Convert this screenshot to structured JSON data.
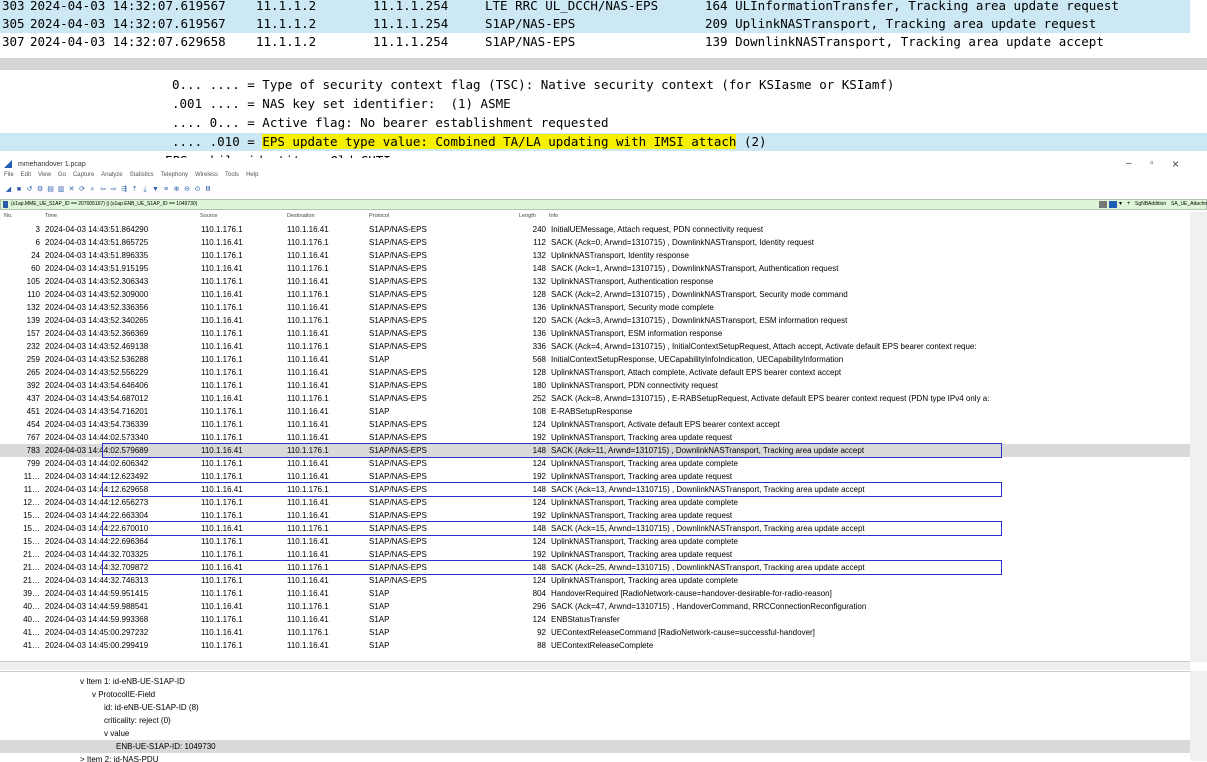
{
  "top_packets": [
    {
      "no": "303",
      "time": "2024-04-03 14:32:07.619567",
      "src": "11.1.1.2",
      "dst": "11.1.1.254",
      "proto": "LTE RRC UL_DCCH/NAS-EPS",
      "info": "164 ULInformationTransfer, Tracking area update request",
      "selected": true
    },
    {
      "no": "305",
      "time": "2024-04-03 14:32:07.619567",
      "src": "11.1.1.2",
      "dst": "11.1.1.254",
      "proto": "S1AP/NAS-EPS",
      "info": "209 UplinkNASTransport, Tracking area update request",
      "selected": true
    },
    {
      "no": "307",
      "time": "2024-04-03 14:32:07.629658",
      "src": "11.1.1.2",
      "dst": "11.1.1.254",
      "proto": "S1AP/NAS-EPS",
      "info": "139 DownlinkNASTransport, Tracking area update accept",
      "selected": false
    }
  ],
  "top_detail": [
    {
      "text": "0... .... = Type of security context flag (TSC): Native security context (for KSIasme or KSIamf)"
    },
    {
      "text": ".001 .... = NAS key set identifier:  (1) ASME"
    },
    {
      "text": ".... 0... = Active flag: No bearer establishment requested"
    },
    {
      "prefix": ".... .010 = ",
      "highlight": "EPS update type value: Combined TA/LA updating with IMSI attach",
      "suffix": " (2)",
      "selected": true
    },
    {
      "text": "v EPS mobile identity - Old GUTI"
    }
  ],
  "window": {
    "title": "mmehandover 1.pcap",
    "menu": [
      "File",
      "Edit",
      "View",
      "Go",
      "Capture",
      "Analyze",
      "Statistics",
      "Telephony",
      "Wireless",
      "Tools",
      "Help"
    ],
    "filter": "(s1ap.MME_UE_S1AP_ID == 207005167) || (s1ap.ENB_UE_S1AP_ID == 1049730)",
    "filter_buttons": [
      "SgNBAddition",
      "SA_UE_Attachment"
    ],
    "minimize": "–",
    "maximize": "▫",
    "close": "×",
    "columns": {
      "no": "No.",
      "time": "Time",
      "src": "Source",
      "dst": "Destination",
      "proto": "Protocol",
      "len": "Length",
      "info": "Info"
    }
  },
  "packets": [
    {
      "no": "3",
      "time": "2024-04-03 14:43:51.864290",
      "src": "110.1.176.1",
      "dst": "110.1.16.41",
      "proto": "S1AP/NAS-EPS",
      "len": "240",
      "info": "InitialUEMessage, Attach request, PDN connectivity request"
    },
    {
      "no": "6",
      "time": "2024-04-03 14:43:51.865725",
      "src": "110.1.16.41",
      "dst": "110.1.176.1",
      "proto": "S1AP/NAS-EPS",
      "len": "112",
      "info": "SACK (Ack=0, Arwnd=1310715) , DownlinkNASTransport, Identity request"
    },
    {
      "no": "24",
      "time": "2024-04-03 14:43:51.896335",
      "src": "110.1.176.1",
      "dst": "110.1.16.41",
      "proto": "S1AP/NAS-EPS",
      "len": "132",
      "info": "UplinkNASTransport, Identity response"
    },
    {
      "no": "60",
      "time": "2024-04-03 14:43:51.915195",
      "src": "110.1.16.41",
      "dst": "110.1.176.1",
      "proto": "S1AP/NAS-EPS",
      "len": "148",
      "info": "SACK (Ack=1, Arwnd=1310715) , DownlinkNASTransport, Authentication request"
    },
    {
      "no": "105",
      "time": "2024-04-03 14:43:52.306343",
      "src": "110.1.176.1",
      "dst": "110.1.16.41",
      "proto": "S1AP/NAS-EPS",
      "len": "132",
      "info": "UplinkNASTransport, Authentication response"
    },
    {
      "no": "110",
      "time": "2024-04-03 14:43:52.309000",
      "src": "110.1.16.41",
      "dst": "110.1.176.1",
      "proto": "S1AP/NAS-EPS",
      "len": "128",
      "info": "SACK (Ack=2, Arwnd=1310715) , DownlinkNASTransport, Security mode command"
    },
    {
      "no": "132",
      "time": "2024-04-03 14:43:52.336356",
      "src": "110.1.176.1",
      "dst": "110.1.16.41",
      "proto": "S1AP/NAS-EPS",
      "len": "136",
      "info": "UplinkNASTransport, Security mode complete"
    },
    {
      "no": "139",
      "time": "2024-04-03 14:43:52.340265",
      "src": "110.1.16.41",
      "dst": "110.1.176.1",
      "proto": "S1AP/NAS-EPS",
      "len": "120",
      "info": "SACK (Ack=3, Arwnd=1310715) , DownlinkNASTransport, ESM information request"
    },
    {
      "no": "157",
      "time": "2024-04-03 14:43:52.366369",
      "src": "110.1.176.1",
      "dst": "110.1.16.41",
      "proto": "S1AP/NAS-EPS",
      "len": "136",
      "info": "UplinkNASTransport, ESM information response"
    },
    {
      "no": "232",
      "time": "2024-04-03 14:43:52.469138",
      "src": "110.1.16.41",
      "dst": "110.1.176.1",
      "proto": "S1AP/NAS-EPS",
      "len": "336",
      "info": "SACK (Ack=4, Arwnd=1310715) , InitialContextSetupRequest, Attach accept, Activate default EPS bearer context reque:"
    },
    {
      "no": "259",
      "time": "2024-04-03 14:43:52.536288",
      "src": "110.1.176.1",
      "dst": "110.1.16.41",
      "proto": "S1AP",
      "len": "568",
      "info": "InitialContextSetupResponse, UECapabilityInfoIndication, UECapabilityInformation"
    },
    {
      "no": "265",
      "time": "2024-04-03 14:43:52.556229",
      "src": "110.1.176.1",
      "dst": "110.1.16.41",
      "proto": "S1AP/NAS-EPS",
      "len": "128",
      "info": "UplinkNASTransport, Attach complete, Activate default EPS bearer context accept"
    },
    {
      "no": "392",
      "time": "2024-04-03 14:43:54.646406",
      "src": "110.1.176.1",
      "dst": "110.1.16.41",
      "proto": "S1AP/NAS-EPS",
      "len": "180",
      "info": "UplinkNASTransport, PDN connectivity request"
    },
    {
      "no": "437",
      "time": "2024-04-03 14:43:54.687012",
      "src": "110.1.16.41",
      "dst": "110.1.176.1",
      "proto": "S1AP/NAS-EPS",
      "len": "252",
      "info": "SACK (Ack=8, Arwnd=1310715) , E-RABSetupRequest, Activate default EPS bearer context request (PDN type IPv4 only a:"
    },
    {
      "no": "451",
      "time": "2024-04-03 14:43:54.716201",
      "src": "110.1.176.1",
      "dst": "110.1.16.41",
      "proto": "S1AP",
      "len": "108",
      "info": "E-RABSetupResponse"
    },
    {
      "no": "454",
      "time": "2024-04-03 14:43:54.736339",
      "src": "110.1.176.1",
      "dst": "110.1.16.41",
      "proto": "S1AP/NAS-EPS",
      "len": "124",
      "info": "UplinkNASTransport, Activate default EPS bearer context accept"
    },
    {
      "no": "767",
      "time": "2024-04-03 14:44:02.573340",
      "src": "110.1.176.1",
      "dst": "110.1.16.41",
      "proto": "S1AP/NAS-EPS",
      "len": "192",
      "info": "UplinkNASTransport, Tracking area update request"
    },
    {
      "no": "783",
      "time": "2024-04-03 14:44:02.579689",
      "src": "110.1.16.41",
      "dst": "110.1.176.1",
      "proto": "S1AP/NAS-EPS",
      "len": "148",
      "info": "SACK (Ack=11, Arwnd=1310715) , DownlinkNASTransport, Tracking area update accept",
      "selected": true,
      "boxed": true
    },
    {
      "no": "799",
      "time": "2024-04-03 14:44:02.606342",
      "src": "110.1.176.1",
      "dst": "110.1.16.41",
      "proto": "S1AP/NAS-EPS",
      "len": "124",
      "info": "UplinkNASTransport, Tracking area update complete"
    },
    {
      "no": "11…",
      "time": "2024-04-03 14:44:12.623492",
      "src": "110.1.176.1",
      "dst": "110.1.16.41",
      "proto": "S1AP/NAS-EPS",
      "len": "192",
      "info": "UplinkNASTransport, Tracking area update request"
    },
    {
      "no": "11…",
      "time": "2024-04-03 14:44:12.629658",
      "src": "110.1.16.41",
      "dst": "110.1.176.1",
      "proto": "S1AP/NAS-EPS",
      "len": "148",
      "info": "SACK (Ack=13, Arwnd=1310715) , DownlinkNASTransport, Tracking area update accept",
      "boxed": true
    },
    {
      "no": "12…",
      "time": "2024-04-03 14:44:12.656273",
      "src": "110.1.176.1",
      "dst": "110.1.16.41",
      "proto": "S1AP/NAS-EPS",
      "len": "124",
      "info": "UplinkNASTransport, Tracking area update complete"
    },
    {
      "no": "15…",
      "time": "2024-04-03 14:44:22.663304",
      "src": "110.1.176.1",
      "dst": "110.1.16.41",
      "proto": "S1AP/NAS-EPS",
      "len": "192",
      "info": "UplinkNASTransport, Tracking area update request"
    },
    {
      "no": "15…",
      "time": "2024-04-03 14:44:22.670010",
      "src": "110.1.16.41",
      "dst": "110.1.176.1",
      "proto": "S1AP/NAS-EPS",
      "len": "148",
      "info": "SACK (Ack=15, Arwnd=1310715) , DownlinkNASTransport, Tracking area update accept",
      "boxed": true
    },
    {
      "no": "15…",
      "time": "2024-04-03 14:44:22.696364",
      "src": "110.1.176.1",
      "dst": "110.1.16.41",
      "proto": "S1AP/NAS-EPS",
      "len": "124",
      "info": "UplinkNASTransport, Tracking area update complete"
    },
    {
      "no": "21…",
      "time": "2024-04-03 14:44:32.703325",
      "src": "110.1.176.1",
      "dst": "110.1.16.41",
      "proto": "S1AP/NAS-EPS",
      "len": "192",
      "info": "UplinkNASTransport, Tracking area update request"
    },
    {
      "no": "21…",
      "time": "2024-04-03 14:44:32.709872",
      "src": "110.1.16.41",
      "dst": "110.1.176.1",
      "proto": "S1AP/NAS-EPS",
      "len": "148",
      "info": "SACK (Ack=25, Arwnd=1310715) , DownlinkNASTransport, Tracking area update accept",
      "boxed": true
    },
    {
      "no": "21…",
      "time": "2024-04-03 14:44:32.746313",
      "src": "110.1.176.1",
      "dst": "110.1.16.41",
      "proto": "S1AP/NAS-EPS",
      "len": "124",
      "info": "UplinkNASTransport, Tracking area update complete"
    },
    {
      "no": "39…",
      "time": "2024-04-03 14:44:59.951415",
      "src": "110.1.176.1",
      "dst": "110.1.16.41",
      "proto": "S1AP",
      "len": "804",
      "info": "HandoverRequired [RadioNetwork-cause=handover-desirable-for-radio-reason]"
    },
    {
      "no": "40…",
      "time": "2024-04-03 14:44:59.988541",
      "src": "110.1.16.41",
      "dst": "110.1.176.1",
      "proto": "S1AP",
      "len": "296",
      "info": "SACK (Ack=47, Arwnd=1310715) , HandoverCommand, RRCConnectionReconfiguration"
    },
    {
      "no": "40…",
      "time": "2024-04-03 14:44:59.993368",
      "src": "110.1.176.1",
      "dst": "110.1.16.41",
      "proto": "S1AP",
      "len": "124",
      "info": "ENBStatusTransfer"
    },
    {
      "no": "41…",
      "time": "2024-04-03 14:45:00.297232",
      "src": "110.1.16.41",
      "dst": "110.1.176.1",
      "proto": "S1AP",
      "len": "92",
      "info": "UEContextReleaseCommand [RadioNetwork-cause=successful-handover]"
    },
    {
      "no": "41…",
      "time": "2024-04-03 14:45:00.299419",
      "src": "110.1.176.1",
      "dst": "110.1.16.41",
      "proto": "S1AP",
      "len": "88",
      "info": "UEContextReleaseComplete"
    }
  ],
  "detail": [
    {
      "indent": 0,
      "text": "v Item 1: id-eNB-UE-S1AP-ID"
    },
    {
      "indent": 1,
      "text": "v ProtocolIE-Field"
    },
    {
      "indent": 2,
      "text": "id: id-eNB-UE-S1AP-ID (8)"
    },
    {
      "indent": 2,
      "text": "criticality: reject (0)"
    },
    {
      "indent": 2,
      "text": "v value"
    },
    {
      "indent": 3,
      "text": "ENB-UE-S1AP-ID: 1049730",
      "selected": true
    },
    {
      "indent": 0,
      "text": "> Item 2: id-NAS-PDU"
    }
  ]
}
